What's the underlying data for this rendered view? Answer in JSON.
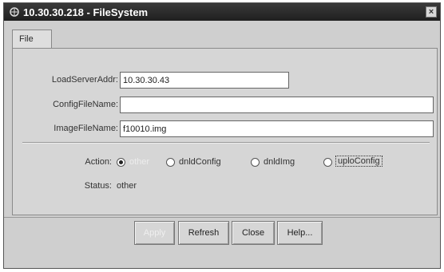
{
  "window": {
    "title": "10.30.30.218 - FileSystem",
    "close_glyph": "×"
  },
  "tabs": [
    {
      "label": "File",
      "selected": true
    }
  ],
  "form": {
    "load_server_addr": {
      "label": "LoadServerAddr:",
      "value": "10.30.30.43"
    },
    "config_file_name": {
      "label": "ConfigFileName:",
      "value": ""
    },
    "image_file_name": {
      "label": "ImageFileName:",
      "value": "f10010.img"
    },
    "action": {
      "label": "Action:",
      "options": [
        {
          "label": "other",
          "checked": true,
          "enabled": false
        },
        {
          "label": "dnldConfig",
          "checked": false,
          "enabled": true
        },
        {
          "label": "dnldImg",
          "checked": false,
          "enabled": true
        },
        {
          "label": "uploConfig",
          "checked": false,
          "enabled": true,
          "focused": true
        }
      ]
    },
    "status": {
      "label": "Status:",
      "value": "other"
    }
  },
  "buttons": {
    "apply": {
      "label": "Apply",
      "enabled": false
    },
    "refresh": {
      "label": "Refresh"
    },
    "close": {
      "label": "Close"
    },
    "help": {
      "label": "Help..."
    }
  },
  "colors": {
    "titlebar": "#2a2a2a",
    "background": "#d6d6d6"
  }
}
